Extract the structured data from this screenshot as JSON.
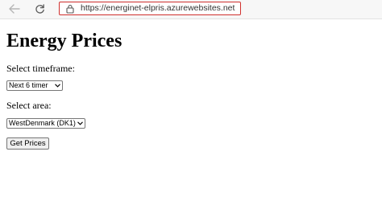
{
  "browser": {
    "url": "https://energinet-elpris.azurewebsites.net",
    "icons": {
      "back": "back-arrow-icon",
      "reload": "reload-icon",
      "lock": "lock-icon"
    },
    "colors": {
      "address_highlight": "#d0302e"
    }
  },
  "page": {
    "title": "Energy Prices",
    "timeframe_label": "Select timeframe:",
    "timeframe_selected": "Next 6 timer",
    "area_label": "Select area:",
    "area_selected": "WestDenmark (DK1)",
    "submit_label": "Get Prices"
  }
}
